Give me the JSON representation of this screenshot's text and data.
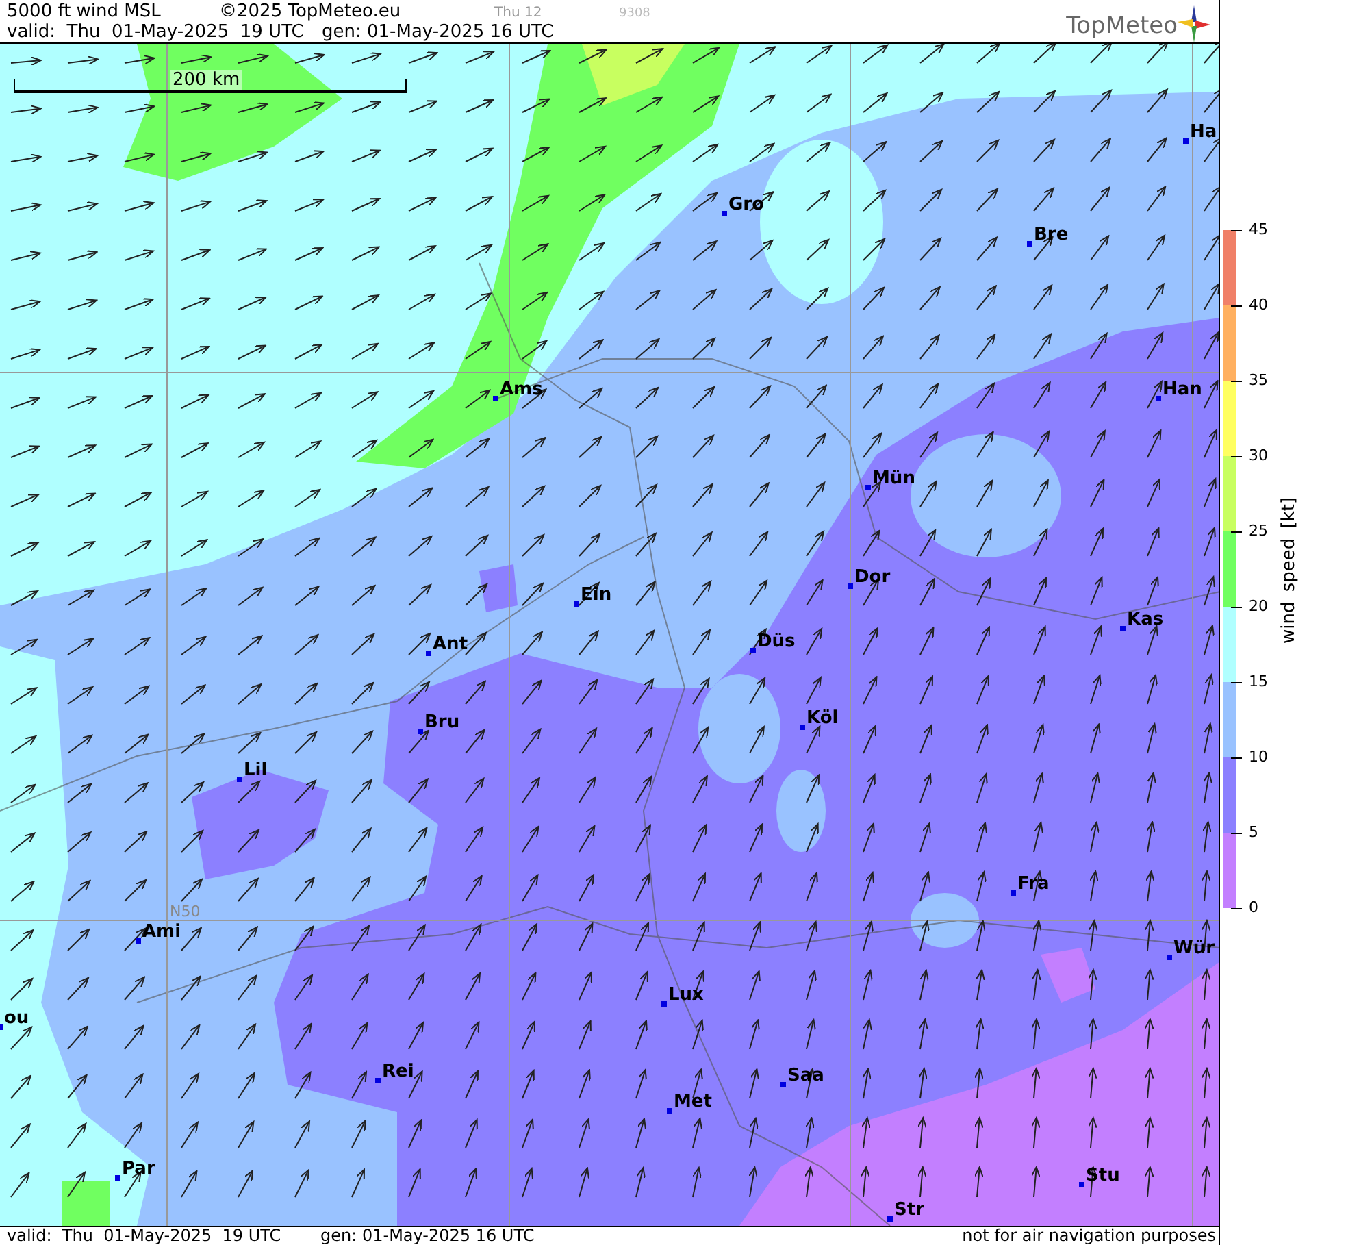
{
  "header": {
    "title": "5000 ft wind MSL",
    "copyright": "©2025 TopMeteo.eu",
    "run_label": "Thu 12",
    "code": "9308",
    "valid": "valid:  Thu  01-May-2025  19 UTC",
    "generated": "gen: 01-May-2025 16 UTC",
    "logo_text": "TopMeteo"
  },
  "map": {
    "scale_label": "200 km",
    "grid_label": "N50",
    "cities": [
      {
        "name": "Ha"
      },
      {
        "name": "Gro"
      },
      {
        "name": "Bre"
      },
      {
        "name": "Ams"
      },
      {
        "name": "Han"
      },
      {
        "name": "Mün"
      },
      {
        "name": "Dor"
      },
      {
        "name": "Ein"
      },
      {
        "name": "Kas"
      },
      {
        "name": "Düs"
      },
      {
        "name": "Ant"
      },
      {
        "name": "Köl"
      },
      {
        "name": "Bru"
      },
      {
        "name": "Lil"
      },
      {
        "name": "Fra"
      },
      {
        "name": "Ami"
      },
      {
        "name": "Wür"
      },
      {
        "name": "Lux"
      },
      {
        "name": "ou"
      },
      {
        "name": "Rei"
      },
      {
        "name": "Saa"
      },
      {
        "name": "Met"
      },
      {
        "name": "Par"
      },
      {
        "name": "Stu"
      },
      {
        "name": "Str"
      }
    ]
  },
  "legend": {
    "title": "wind speed [kt]",
    "ticks": [
      "45",
      "40",
      "35",
      "30",
      "25",
      "20",
      "15",
      "10",
      "5",
      "0"
    ],
    "bands": [
      {
        "color": "#f08068"
      },
      {
        "color": "#ffb060"
      },
      {
        "color": "#ffff60"
      },
      {
        "color": "#c8ff60"
      },
      {
        "color": "#70ff60"
      },
      {
        "color": "#b0ffff"
      },
      {
        "color": "#99c2ff"
      },
      {
        "color": "#8c80ff"
      },
      {
        "color": "#c37fff"
      }
    ]
  },
  "footer": {
    "valid": "valid:  Thu  01-May-2025  19 UTC",
    "generated": "gen: 01-May-2025 16 UTC",
    "notice": "not for air navigation purposes"
  }
}
